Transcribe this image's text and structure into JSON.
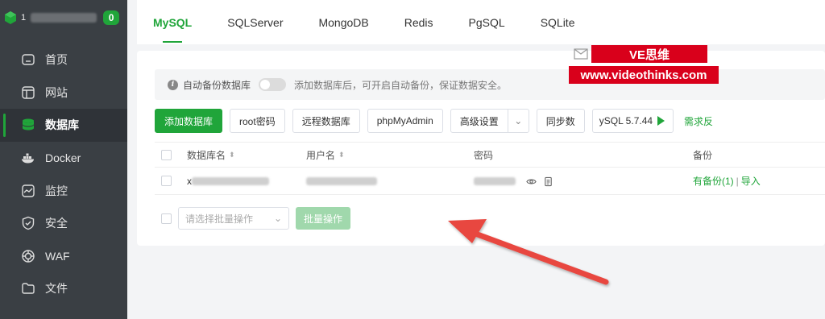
{
  "sidebar": {
    "host_prefix": "1",
    "badge": "0",
    "items": [
      {
        "label": "首页",
        "icon": "home-icon"
      },
      {
        "label": "网站",
        "icon": "website-icon"
      },
      {
        "label": "数据库",
        "icon": "database-icon",
        "active": true
      },
      {
        "label": "Docker",
        "icon": "docker-icon"
      },
      {
        "label": "监控",
        "icon": "monitor-icon"
      },
      {
        "label": "安全",
        "icon": "shield-icon"
      },
      {
        "label": "WAF",
        "icon": "waf-icon"
      },
      {
        "label": "文件",
        "icon": "folder-icon"
      }
    ]
  },
  "tabs": [
    "MySQL",
    "SQLServer",
    "MongoDB",
    "Redis",
    "PgSQL",
    "SQLite"
  ],
  "active_tab": "MySQL",
  "notice": {
    "label": "自动备份数据库",
    "hint": "添加数据库后，可开启自动备份，保证数据安全。"
  },
  "toolbar": {
    "add_db": "添加数据库",
    "root_pw": "root密码",
    "remote_db": "远程数据库",
    "phpmyadmin": "phpMyAdmin",
    "advanced": "高级设置",
    "sync": "同步数",
    "version": "ySQL 5.7.44",
    "feedback": "需求反"
  },
  "watermark": {
    "line1": "VE思维",
    "line2": "www.videothinks.com"
  },
  "table": {
    "headers": {
      "name": "数据库名",
      "user": "用户名",
      "password": "密码",
      "backup": "备份"
    },
    "row": {
      "name_prefix": "x",
      "backup_link": "有备份(1)",
      "import_link": "导入",
      "sep": "|"
    }
  },
  "bulk": {
    "placeholder": "请选择批量操作",
    "button": "批量操作"
  },
  "colors": {
    "accent": "#20a53a",
    "sidebar_bg": "#3a3f44",
    "annotation_arrow": "#e8473f",
    "watermark_red": "#d9001b"
  }
}
